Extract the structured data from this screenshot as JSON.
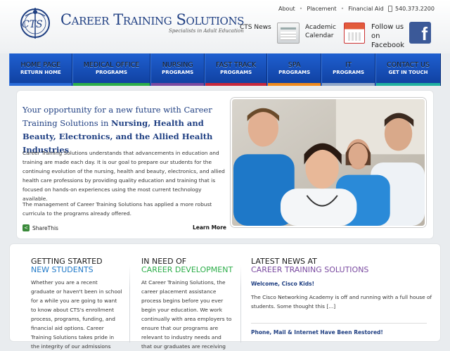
{
  "brand": {
    "title": "Career Training Solutions",
    "tagline": "Specialists in Adult Education",
    "logo_text": "CTS",
    "color": "#1f3f82"
  },
  "top_links": [
    "About",
    "Placement",
    "Financial Aid"
  ],
  "phone": "540.373.2200",
  "header": {
    "cts_news": "CTS News",
    "calendar_label": "Academic Calendar",
    "facebook_label": "Follow us on Facebook",
    "facebook_glyph": "f"
  },
  "nav": [
    {
      "title": "HOME PAGE",
      "sub": "RETURN HOME",
      "color": "#2a6bd8"
    },
    {
      "title": "MEDICAL OFFICE",
      "sub": "PROGRAMS",
      "color": "#2dae4a"
    },
    {
      "title": "NURSING",
      "sub": "PROGRAMS",
      "color": "#7a4aa0"
    },
    {
      "title": "FAST TRACK",
      "sub": "PROGRAMS",
      "color": "#c8283c"
    },
    {
      "title": "SPA",
      "sub": "PROGRAMS",
      "color": "#f08a1c"
    },
    {
      "title": "IT",
      "sub": "PROGRAMS",
      "color": "#8fa6c8"
    },
    {
      "title": "CONTACT US",
      "sub": "GET IN TOUCH",
      "color": "#20b0a0"
    }
  ],
  "hero": {
    "headline_pre": "Your opportunity for a new future with Career Training Solutions in ",
    "headline_bold": "Nursing, Health and Beauty, Electronics, and the Allied Health Industries",
    "p1": "Career Training Solutions understands that advancements in education and training are made each day. It is our goal to prepare our students for the continuing evolution of the nursing, health and beauty, electronics, and allied health care professions by providing quality education and training that is focused on hands-on experiences using the most current technology available.",
    "p2": "The management of Career Training Solutions has applied a more robust curricula to the programs already offered.",
    "share": "ShareThis",
    "learn_more": "Learn More"
  },
  "columns": {
    "getting_started": {
      "h1": "GETTING STARTED",
      "h2": "NEW STUDENTS",
      "text": "Whether you are a recent graduate or haven't been in school for a while you are going to want to know about CTS's enrollment process, programs, funding, and financial aid options. Career Training Solutions takes pride in the integrity of our admissions"
    },
    "career": {
      "h1": "IN NEED OF",
      "h2": "CAREER DEVELOPMENT",
      "text": "At Career Training Solutions, the career placement assistance process begins before you ever begin your education. We work continually with area employers to ensure that our programs are relevant to industry needs and that our graduates are receiving"
    },
    "news": {
      "h1": "LATEST NEWS AT",
      "h2": "CAREER TRAINING SOLUTIONS",
      "item1_title": "Welcome, Cisco Kids!",
      "item1_text": "The Cisco Networking Academy is off and running with a full house of students. Some thought this [...]",
      "item2_title": "Phone, Mail & Internet Have Been Restored!"
    }
  }
}
